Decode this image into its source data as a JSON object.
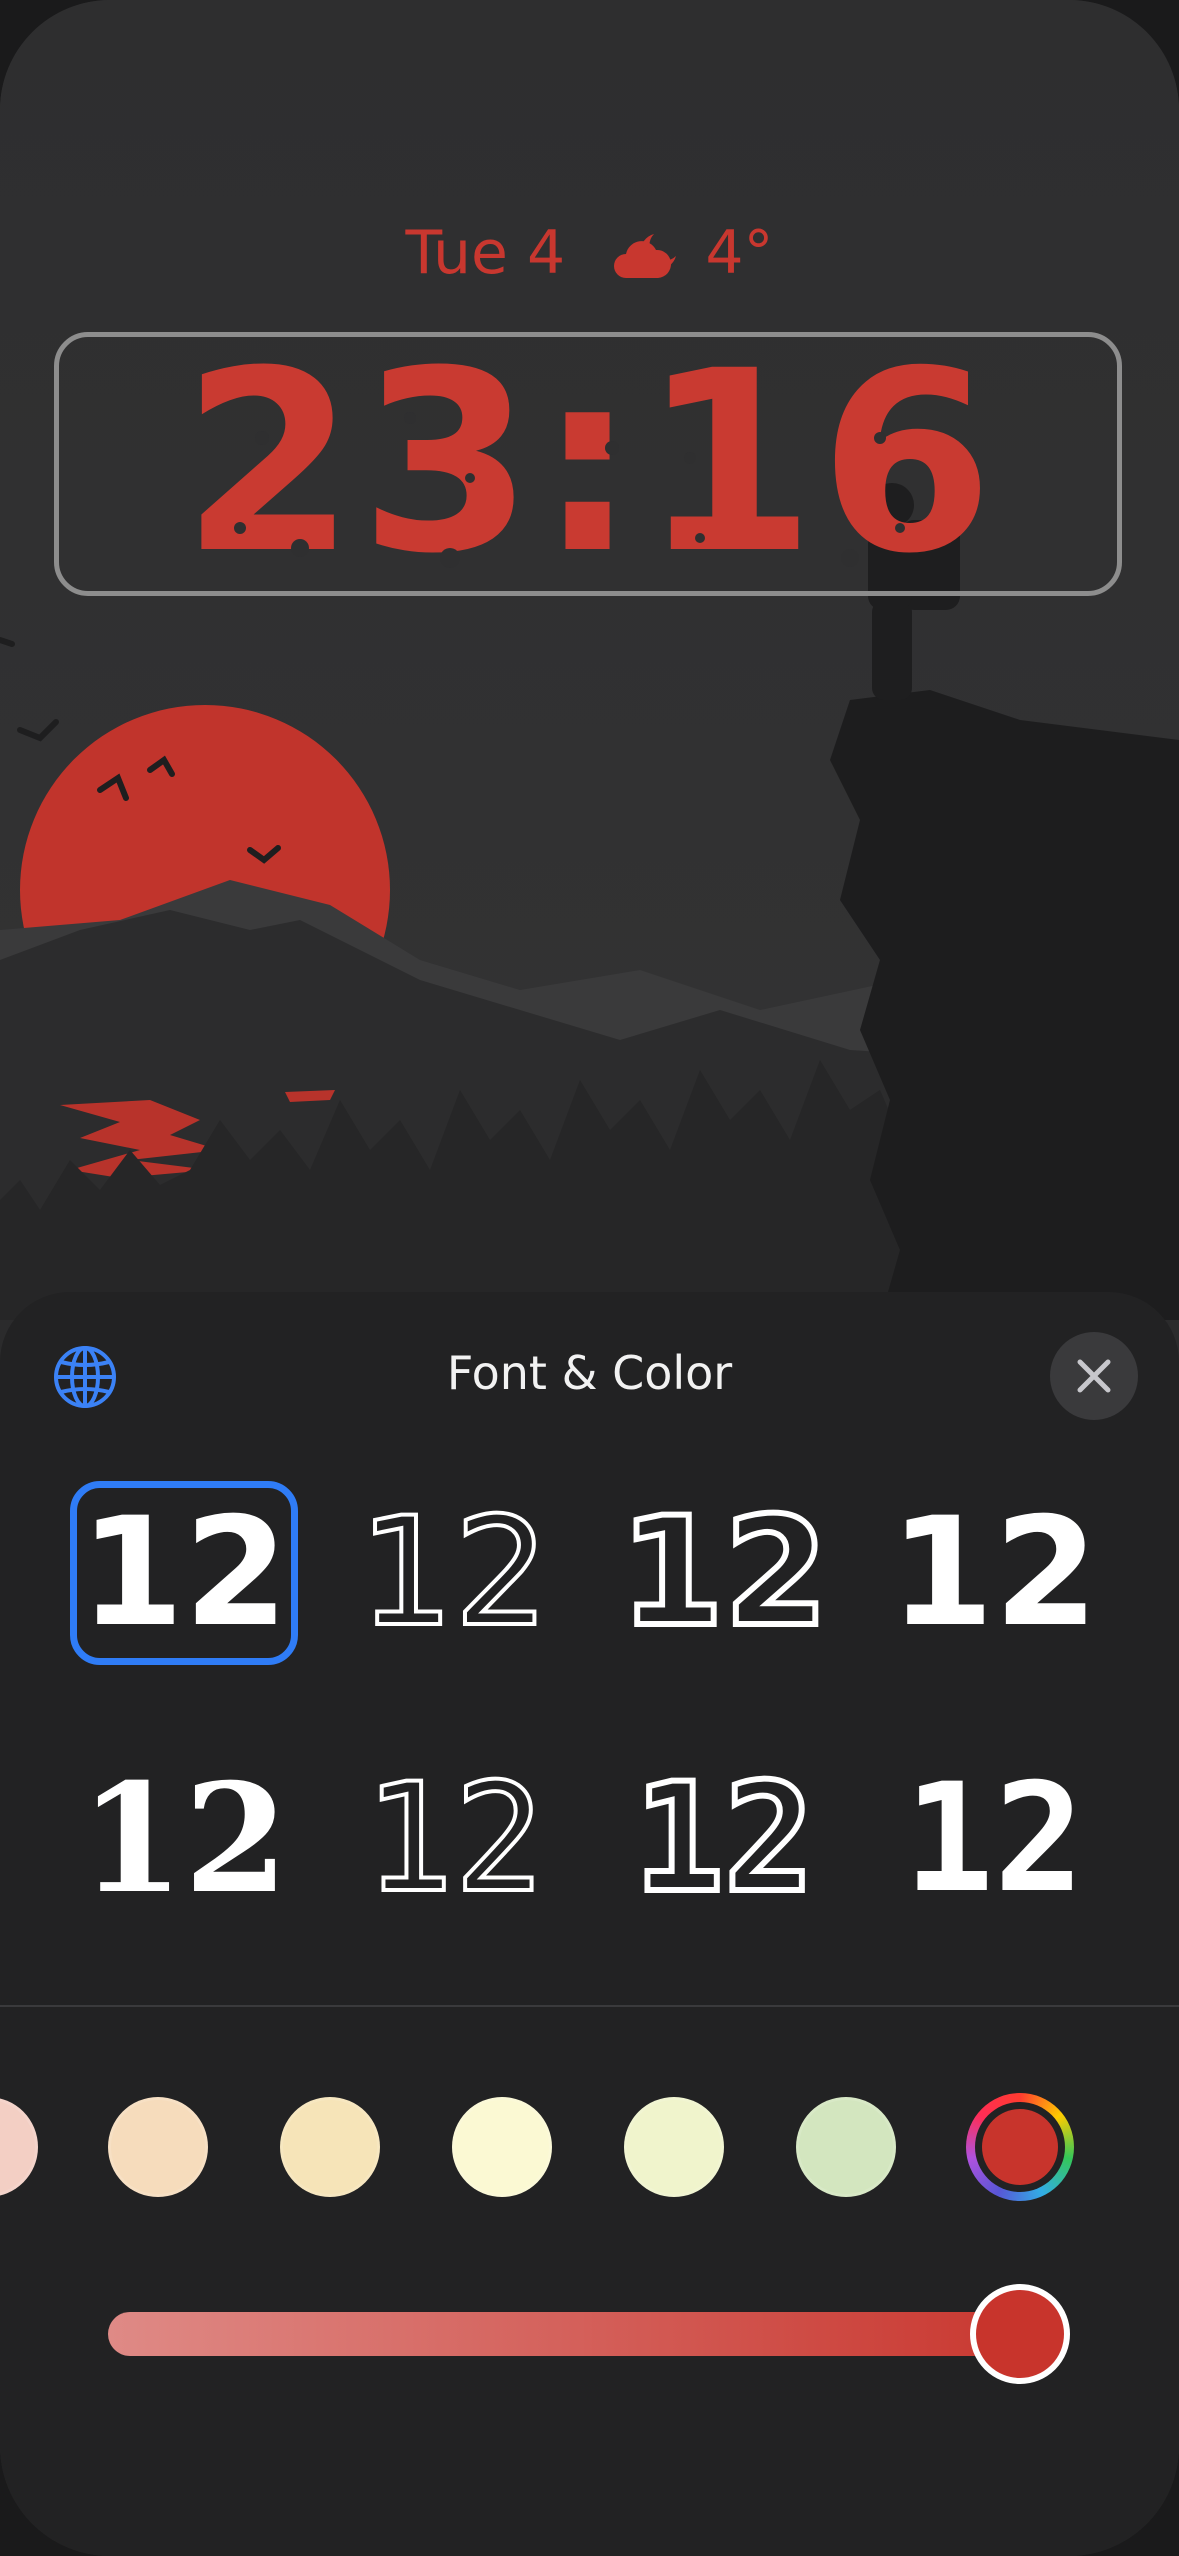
{
  "lock_screen": {
    "date": "Tue 4",
    "weather_icon": "cloud-moon-icon",
    "temperature": "4°",
    "time": "23:16",
    "clock_color": "#c93a31"
  },
  "sheet": {
    "title": "Font & Color",
    "globe_icon": "globe-icon",
    "close_icon": "close-icon"
  },
  "fonts": [
    {
      "label": "12",
      "style": "space-rounded",
      "selected": true
    },
    {
      "label": "12",
      "style": "thin-outline",
      "selected": false
    },
    {
      "label": "12",
      "style": "bold-outline",
      "selected": false
    },
    {
      "label": "12",
      "style": "bold-solid",
      "selected": false
    },
    {
      "label": "12",
      "style": "cat-silhouette",
      "selected": false
    },
    {
      "label": "12",
      "style": "stencil-outline",
      "selected": false
    },
    {
      "label": "12",
      "style": "stencil-double-outline",
      "selected": false
    },
    {
      "label": "12",
      "style": "stencil-solid",
      "selected": false
    }
  ],
  "colors": {
    "swatches": [
      "#f3cfc4",
      "#f6dcbc",
      "#f6e4b8",
      "#fbf9d3",
      "#f0f4cc",
      "#d3e6bf"
    ],
    "selected_color": "#c8342c",
    "accent": "#2f7cf6"
  },
  "slider": {
    "value": 1.0
  }
}
